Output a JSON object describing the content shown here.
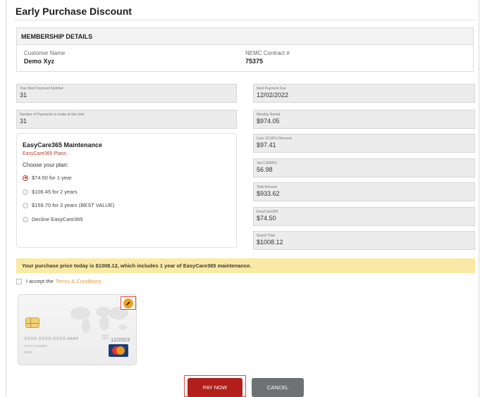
{
  "page": {
    "title": "Early Purchase Discount"
  },
  "membership": {
    "heading": "MEMBERSHIP DETAILS",
    "customer_label": "Customer Name",
    "customer_value": "Demo Xyz",
    "contract_label": "NEMC Contract #",
    "contract_value": "75375"
  },
  "fields_left": [
    {
      "label": "Your Next Payment Number",
      "value": "31"
    },
    {
      "label": "Number of Payments to make at this time",
      "value": "31"
    }
  ],
  "fields_right": [
    {
      "label": "Next Payment Due",
      "value": "12/02/2022"
    },
    {
      "label": "Monthly Rental",
      "value": "$974.05"
    },
    {
      "label": "Less 10.00% Discount",
      "value": "$97.41"
    },
    {
      "label": "Tax 6.5000%",
      "value": "56.98"
    },
    {
      "label": "Total Amount",
      "value": "$933.62"
    },
    {
      "label": "EasyCare365",
      "value": "$74.50"
    },
    {
      "label": "Grand Total",
      "value": "$1008.12"
    }
  ],
  "plan": {
    "title": "EasyCare365 Maintenance",
    "subtitle": "EasyCare365 Plans",
    "choose_label": "Choose your plan:",
    "options": [
      {
        "label": "$74.50 for 1 year",
        "selected": true
      },
      {
        "label": "$106.45 for 2 years",
        "selected": false
      },
      {
        "label": "$159.70 for 3 years (BEST VALUE)",
        "selected": false
      },
      {
        "label": "Decline EasyCare365",
        "selected": false
      }
    ]
  },
  "notice": {
    "text": "Your purchase price today is $1008.12, which includes 1 year of EasyCare365 maintenance."
  },
  "terms": {
    "prefix": "I accept the",
    "link": "Terms & Conditions",
    "checked": false
  },
  "card": {
    "number": "XXXX-XXXX-XXXX-4444",
    "holder_label": "CARD HOLDER",
    "holder_name": "nemc",
    "valid_label_1": "VALID",
    "valid_label_2": "THRU",
    "expiry": "12/2023",
    "brand_icon": "mastercard-icon",
    "edit_icon": "pencil-icon"
  },
  "actions": {
    "pay_label": "PAY NOW",
    "cancel_label": "CANCEL"
  },
  "colors": {
    "accent_red": "#b3201c",
    "highlight_outline": "#e04a3a",
    "notice_bg": "#fbeaa5",
    "link_orange": "#e69b3a",
    "cancel_gray": "#6e7275"
  }
}
